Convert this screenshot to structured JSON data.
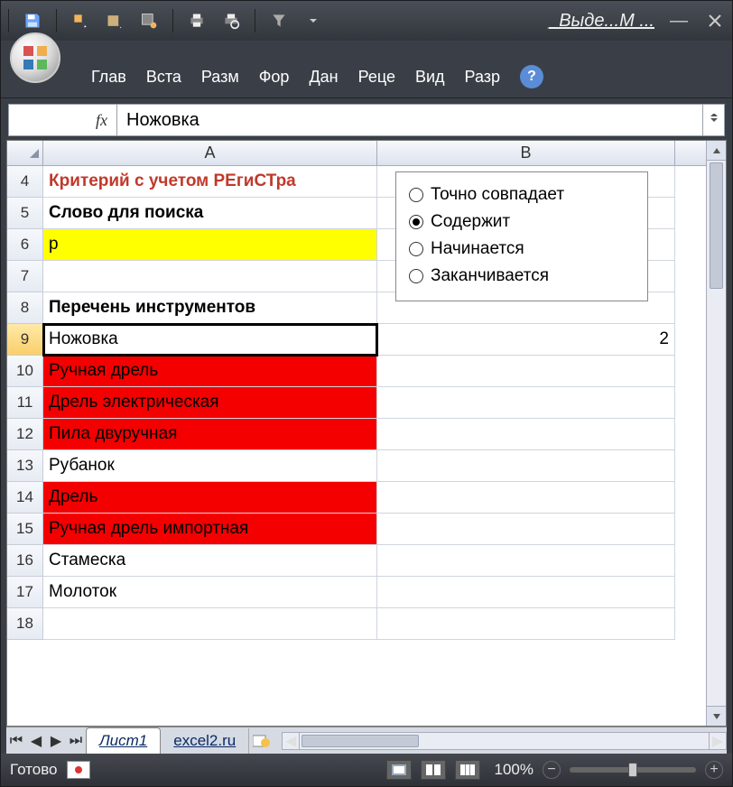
{
  "title": "_Выде...М ...",
  "ribbon_tabs": [
    "Глав",
    "Вста",
    "Разм",
    "Фор",
    "Дан",
    "Реце",
    "Вид",
    "Разр"
  ],
  "formula": {
    "fx": "fx",
    "value": "Ножовка"
  },
  "columns": [
    "A",
    "B"
  ],
  "row_headers": [
    "4",
    "5",
    "6",
    "7",
    "8",
    "9",
    "10",
    "11",
    "12",
    "13",
    "14",
    "15",
    "16",
    "17",
    "18"
  ],
  "active_row": "9",
  "cells": {
    "a4": "Критерий с учетом РЕгиСТра",
    "a5": "Слово для поиска",
    "a6": "р",
    "a7": "",
    "a8": "Перечень инструментов",
    "a9": "Ножовка",
    "b9": "2",
    "a10": "Ручная дрель",
    "a11": "Дрель электрическая",
    "a12": "Пила двуручная",
    "a13": "Рубанок",
    "a14": "Дрель",
    "a15": "Ручная дрель импортная",
    "a16": "Стамеска",
    "a17": "Молоток",
    "a18": ""
  },
  "options": {
    "opt1": "Точно совпадает",
    "opt2": "Содержит",
    "opt3": "Начинается",
    "opt4": "Заканчивается",
    "selected": "opt2"
  },
  "sheet_tabs": {
    "active": "Лист1",
    "second": "excel2.ru"
  },
  "status": {
    "ready": "Готово",
    "zoom": "100%"
  }
}
